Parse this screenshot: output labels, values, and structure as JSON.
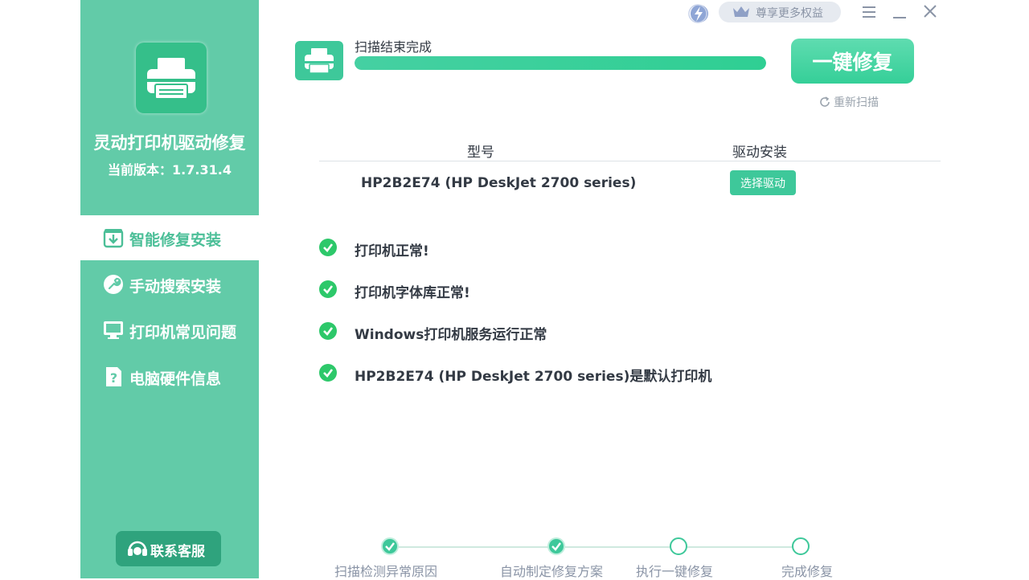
{
  "sidebar": {
    "app_title": "灵动打印机驱动修复",
    "version": "当前版本：1.7.31.4",
    "nav": [
      {
        "label": "智能修复安装",
        "icon": "download-box-icon",
        "active": true
      },
      {
        "label": "手动搜索安装",
        "icon": "wrench-icon",
        "active": false
      },
      {
        "label": "打印机常见问题",
        "icon": "monitor-icon",
        "active": false
      },
      {
        "label": "电脑硬件信息",
        "icon": "question-doc-icon",
        "active": false
      }
    ],
    "contact_label": "联系客服"
  },
  "topbar": {
    "vip_label": "尊享更多权益"
  },
  "scan": {
    "status": "扫描结束完成",
    "progress": 1.0,
    "repair_label": "一键修复",
    "rescan_label": "重新扫描"
  },
  "table": {
    "headers": [
      "型号",
      "驱动安装"
    ],
    "rows": [
      {
        "model": "HP2B2E74 (HP DeskJet 2700 series)",
        "action": "选择驱动"
      }
    ]
  },
  "checks": [
    "打印机正常!",
    "打印机字体库正常!",
    "Windows打印机服务运行正常",
    "HP2B2E74 (HP DeskJet 2700 series)是默认打印机"
  ],
  "steps": [
    {
      "label": "扫描检测异常原因",
      "done": true
    },
    {
      "label": "自动制定修复方案",
      "done": true
    },
    {
      "label": "执行一键修复",
      "done": false
    },
    {
      "label": "完成修复",
      "done": false
    }
  ],
  "colors": {
    "sidebar": "#62cba8",
    "accent": "#3ec89a",
    "text": "#333a44"
  }
}
